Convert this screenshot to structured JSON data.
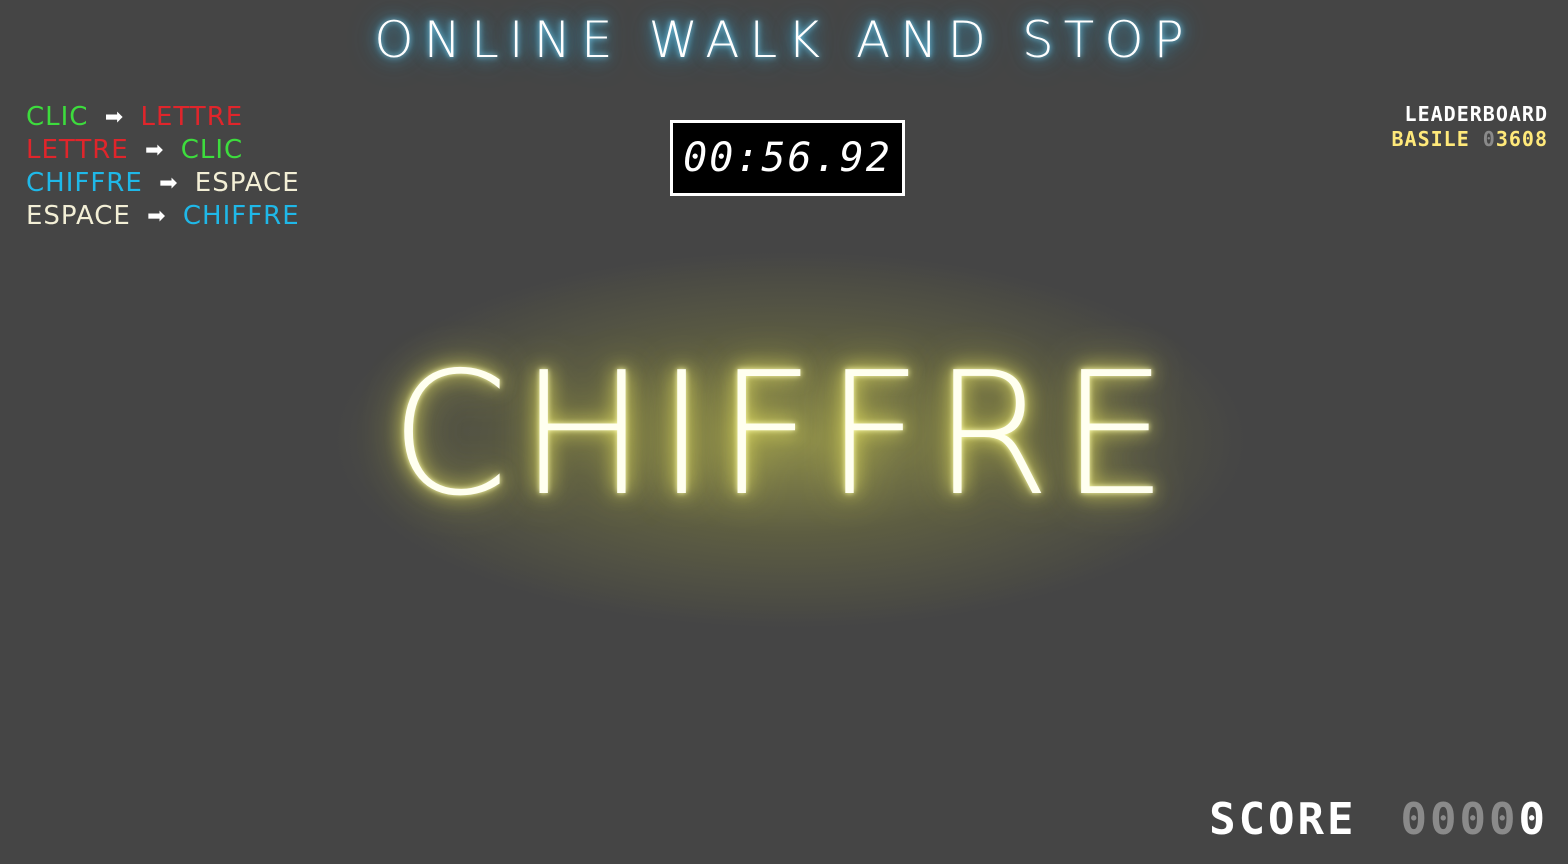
{
  "game": {
    "title": "ONLINE WALK AND STOP",
    "current_instruction": "CHIFFRE"
  },
  "rules": [
    {
      "from": "CLIC",
      "from_color": "#3ddc3d",
      "to": "LETTRE",
      "to_color": "#e0252b"
    },
    {
      "from": "LETTRE",
      "from_color": "#e0252b",
      "to": "CLIC",
      "to_color": "#3ddc3d"
    },
    {
      "from": "CHIFFRE",
      "from_color": "#1fb8e8",
      "to": "ESPACE",
      "to_color": "#f3efd6"
    },
    {
      "from": "ESPACE",
      "from_color": "#f3efd6",
      "to": "CHIFFRE",
      "to_color": "#1fb8e8"
    }
  ],
  "arrow_icon": "arrow-right-icon",
  "timer": {
    "value": "00:56.92"
  },
  "leaderboard": {
    "title": "LEADERBOARD",
    "entries": [
      {
        "name": "BASILE",
        "score_pad": "0",
        "score": "3608"
      }
    ]
  },
  "score": {
    "label": "SCORE",
    "pad": "0000",
    "value": "0"
  },
  "colors": {
    "background": "#454545",
    "title_glow": "#39b8e8",
    "word_glow": "#f3ef6a",
    "leaderboard_entry": "#ffe97a"
  }
}
